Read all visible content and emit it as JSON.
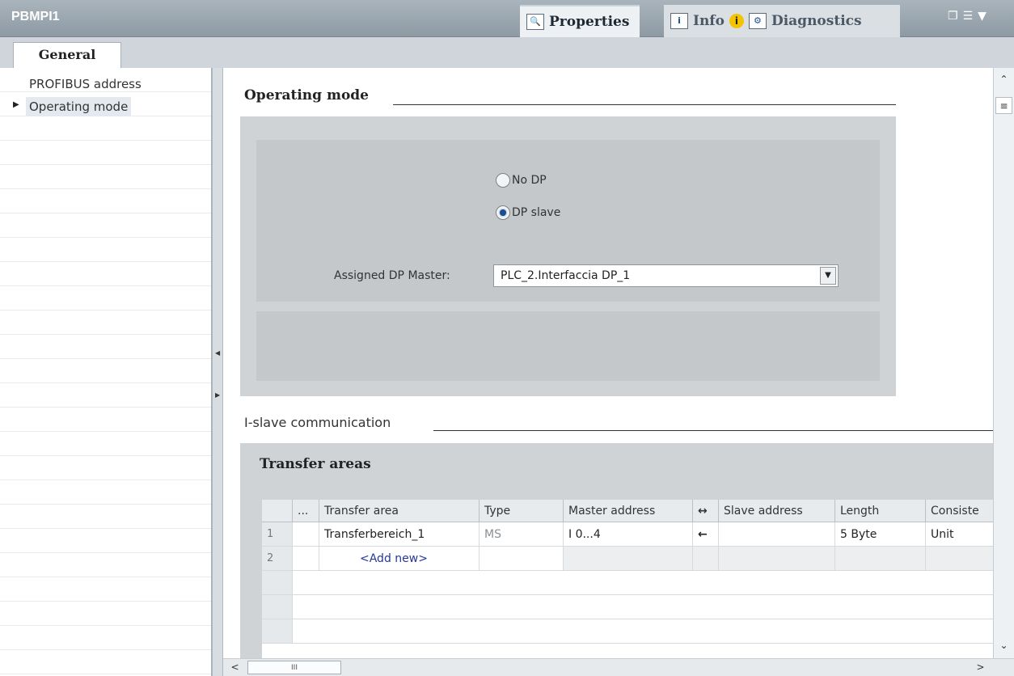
{
  "window": {
    "title": "PBMPI1",
    "tabs": {
      "properties": "Properties",
      "info": "Info",
      "diagnostics": "Diagnostics"
    },
    "controls": [
      "restore-icon",
      "list-icon",
      "dropdown-icon"
    ]
  },
  "section_tab": "General",
  "nav": {
    "items": [
      {
        "label": "PROFIBUS address"
      },
      {
        "label": "Operating mode",
        "selected": true
      }
    ]
  },
  "operating_mode": {
    "title": "Operating mode",
    "options": [
      {
        "label": "No DP",
        "checked": false
      },
      {
        "label": "DP slave",
        "checked": true
      }
    ],
    "master_label": "Assigned DP Master:",
    "master_value": "PLC_2.Interfaccia DP_1"
  },
  "islave": {
    "title": "I-slave communication",
    "transfer_title": "Transfer areas",
    "columns": [
      "...",
      "Transfer area",
      "Type",
      "Master address",
      "↔",
      "Slave address",
      "Length",
      "Consiste"
    ],
    "rows": [
      {
        "num": "1",
        "area": "Transferbereich_1",
        "type": "MS",
        "master": "I 0...4",
        "dir": "←",
        "slave": "",
        "length": "5 Byte",
        "consistency": "Unit"
      },
      {
        "num": "2",
        "area": "<Add new>"
      }
    ]
  },
  "scrollbar": {
    "thumb_label": "III"
  },
  "colors": {
    "accent": "#1d4e8f",
    "title_bar": "#9aa6ae",
    "panel": "#cfd3d6"
  }
}
